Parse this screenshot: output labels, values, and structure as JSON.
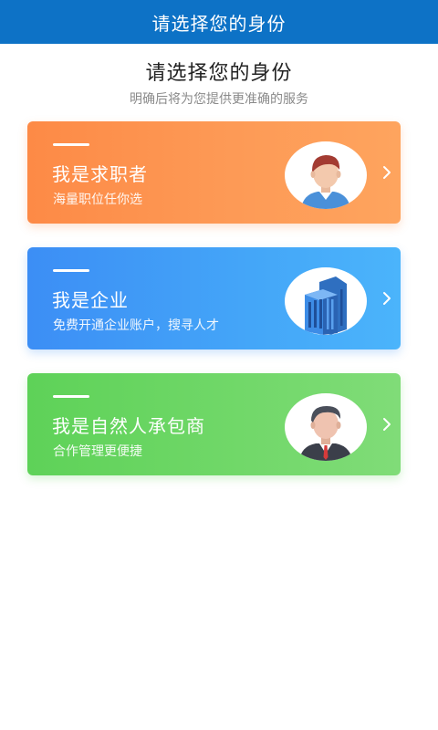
{
  "header": {
    "title": "请选择您的身份"
  },
  "main": {
    "heading": "请选择您的身份",
    "subheading": "明确后将为您提供更准确的服务"
  },
  "cards": [
    {
      "title": "我是求职者",
      "description": "海量职位任你选",
      "icon": "job-seeker-avatar-icon",
      "color": "#fd8a46"
    },
    {
      "title": "我是企业",
      "description": "免费开通企业账户，搜寻人才",
      "icon": "building-icon",
      "color": "#3c8ef5"
    },
    {
      "title": "我是自然人承包商",
      "description": "合作管理更便捷",
      "icon": "businessman-avatar-icon",
      "color": "#5ed258"
    }
  ]
}
